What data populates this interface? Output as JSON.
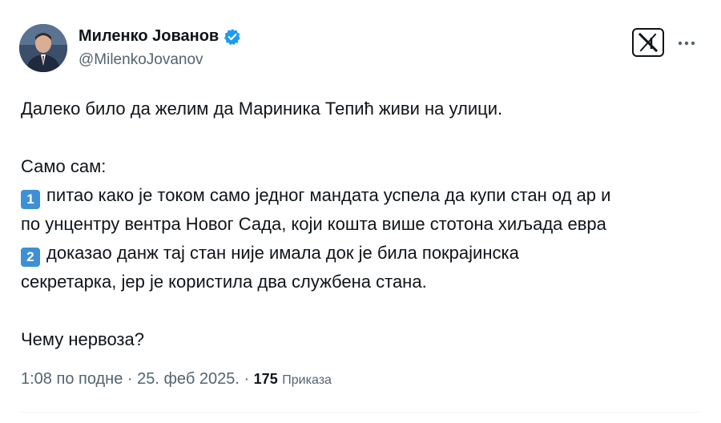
{
  "tweet": {
    "author": {
      "display_name": "Миленко Јованов",
      "handle": "@MilenkoJovanov",
      "verified": true
    },
    "text": {
      "line1": "Далеко било да желим да Мариника Тепић живи на улици.",
      "line2": "Само сам:",
      "item1_badge": "1",
      "item1_line1": "питао како је током само једног мандата успела да купи стан од ар и",
      "item1_line2": "по унцентру вентра Новог Сада, који кошта више стотона хиљада евра",
      "item2_badge": "2",
      "item2_line1": "доказао данж тај стан није имала док је била покрајинска",
      "item2_line2": "секретарка, јер је користила два службена стана.",
      "closing": "Чему нервоза?"
    },
    "meta": {
      "time_date": "1:08 по подне · 25. феб 2025. · ",
      "views_count": "175",
      "views_label": "Приказа"
    }
  },
  "colors": {
    "text_primary": "#0f1419",
    "text_secondary": "#536471",
    "verified_blue": "#1d9bf0",
    "keycap_blue": "#3d8fd6"
  },
  "icons": [
    "avatar",
    "verified-badge-icon",
    "x-logo-icon",
    "more-options-icon"
  ]
}
